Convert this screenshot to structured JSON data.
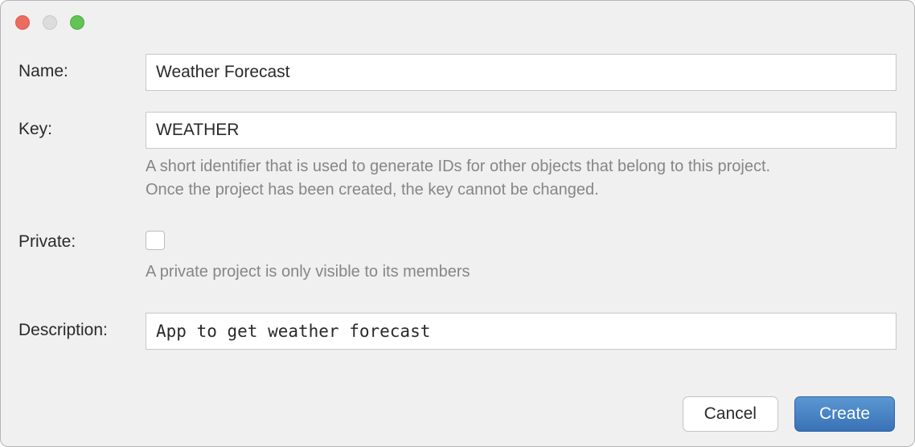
{
  "labels": {
    "name": "Name:",
    "key": "Key:",
    "private": "Private:",
    "description": "Description:"
  },
  "values": {
    "name": "Weather Forecast",
    "key": "WEATHER",
    "description": "App to get weather forecast",
    "private_checked": false
  },
  "hints": {
    "key_line1": "A short identifier that is used to generate IDs for other objects that belong to this project.",
    "key_line2": "Once the project has been created, the key cannot be changed.",
    "private": "A private project is only visible to its members"
  },
  "buttons": {
    "cancel": "Cancel",
    "create": "Create"
  }
}
